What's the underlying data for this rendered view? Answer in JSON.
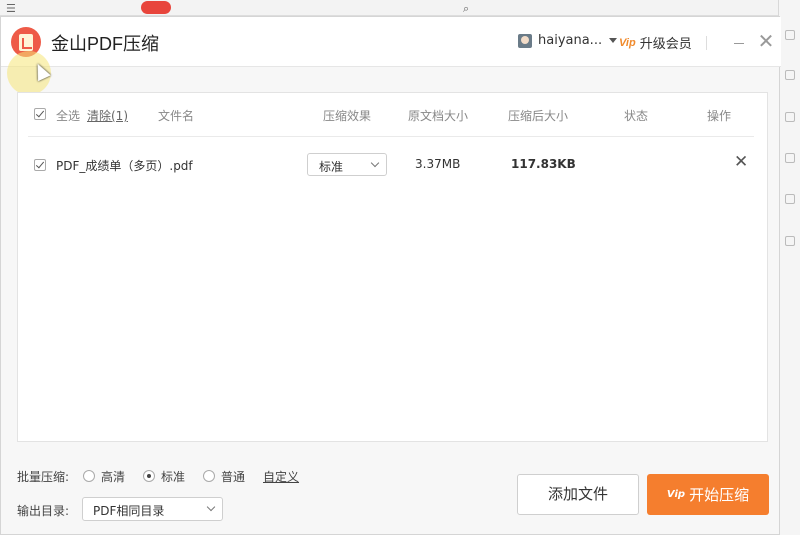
{
  "window": {
    "title": "金山PDF压缩",
    "user_name": "haiyana...",
    "vip_label": "升级会员"
  },
  "table": {
    "select_all_label": "全选",
    "clear_label": "清除(1)",
    "headers": {
      "filename": "文件名",
      "effect": "压缩效果",
      "original_size": "原文档大小",
      "compressed_size": "压缩后大小",
      "status": "状态",
      "action": "操作"
    },
    "rows": [
      {
        "checked": true,
        "filename": "PDF_成绩单（多页）.pdf",
        "effect": "标准",
        "original_size": "3.37MB",
        "compressed_size": "117.83KB",
        "status": ""
      }
    ]
  },
  "footer": {
    "batch_label": "批量压缩:",
    "options": [
      "高清",
      "标准",
      "普通"
    ],
    "selected_option": "标准",
    "custom_label": "自定义",
    "output_label": "输出目录:",
    "output_value": "PDF相同目录",
    "add_button": "添加文件",
    "start_button": "开始压缩"
  },
  "colors": {
    "accent": "#f57e2e",
    "logo": "#ee5b48"
  }
}
